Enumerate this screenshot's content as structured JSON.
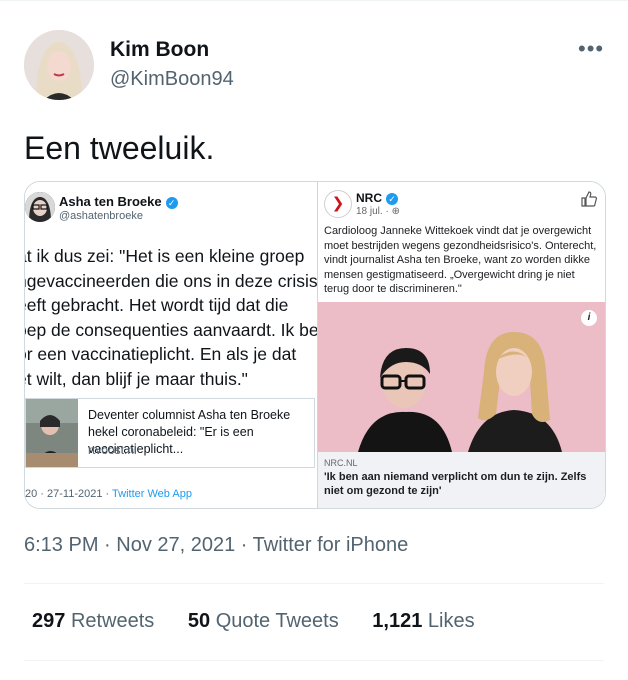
{
  "author": {
    "name": "Kim Boon",
    "handle": "@KimBoon94"
  },
  "more_icon": "ellipsis-icon",
  "tweet": {
    "text": "Een tweeluik."
  },
  "left_panel": {
    "author_name": "Asha ten Broeke",
    "author_handle": "@ashatenbroeke",
    "quote_lines": [
      "at ik dus zei: \"Het is een kleine groep",
      "ngevaccineerden die ons in deze crisis",
      "eeft gebracht. Het wordt tijd dat die",
      "oep de consequenties aanvaardt. Ik be",
      "or een vaccinatieplicht. En als je dat",
      "et wilt, dan blijf je maar thuis.\""
    ],
    "link_title": "Deventer columnist Asha ten Broeke hekel coronabeleid: \"Er is een vaccinatieplicht...",
    "link_domain": "rtvoost.nl",
    "footer_date": "20 · 27-11-2021 · ",
    "footer_app": "Twitter Web App"
  },
  "right_panel": {
    "page_name": "NRC",
    "time": "18 jul. · ",
    "body": "Cardioloog Janneke Wittekoek vindt dat je overgewicht moet bestrijden wegens gezondheidsrisico's. Onterecht, vindt journalist Asha ten Broeke, want zo worden dikke mensen gestigmatiseerd. „Overgewicht dring je niet terug door te discrimineren.\"",
    "link_domain": "NRC.NL",
    "link_headline": "'Ik ben aan niemand verplicht om dun te zijn. Zelfs niet om gezond te zijn'",
    "info_label": "i"
  },
  "meta": {
    "text": "6:13 PM · Nov 27, 2021 · Twitter for iPhone"
  },
  "stats": {
    "retweets_count": "297",
    "retweets_label": "Retweets",
    "quotes_count": "50",
    "quotes_label": "Quote Tweets",
    "likes_count": "1,121",
    "likes_label": "Likes"
  },
  "colors": {
    "accent": "#1d9bf0",
    "secondary_text": "#536471",
    "nrc_red": "#d0121b",
    "photo_bg": "#ecbcc7"
  }
}
